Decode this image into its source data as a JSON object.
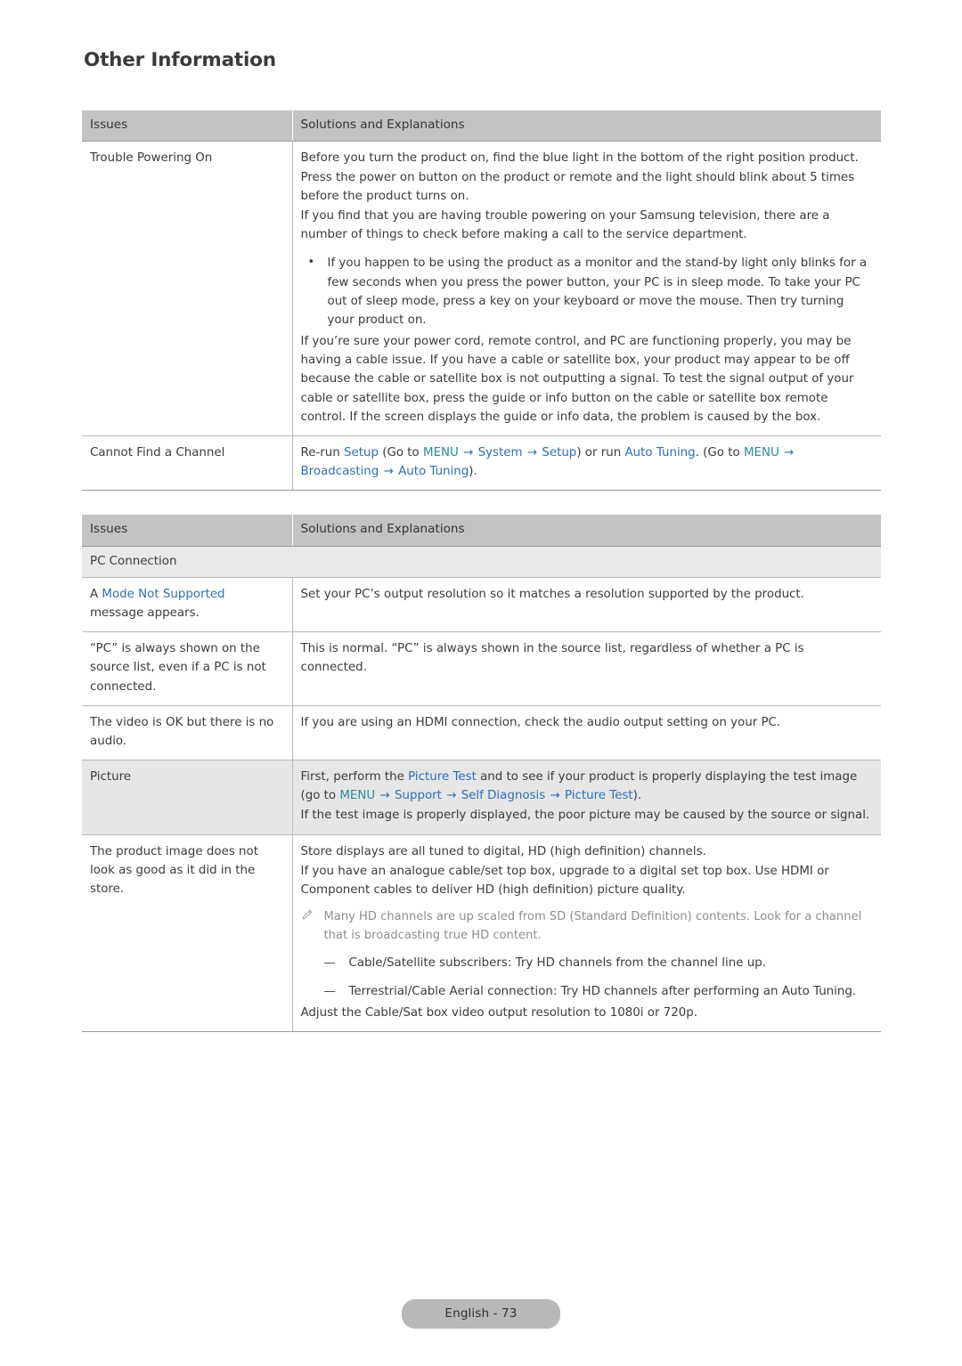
{
  "document": {
    "title": "Other Information",
    "footer_label": "English - 73"
  },
  "colors": {
    "menu_teal": "#2c8b9e",
    "link_blue": "#2f6fb4",
    "header_gray": "#c3c3c3",
    "subhead_gray": "#e9e9e9",
    "shaded_row": "#e6e6e6",
    "note_gray": "#8e8e8e"
  },
  "table1": {
    "headers": {
      "issues": "Issues",
      "solutions": "Solutions and Explanations"
    },
    "rows": [
      {
        "issue": "Trouble Powering On",
        "paragraphs": [
          "Before you turn the product on, find the blue light in the bottom of the right position product. Press the power on button on the product or remote and the light should blink about 5 times before the product turns on.",
          "If you find that you are having trouble powering on your Samsung television, there are a number of things to check before making a call to the service department."
        ],
        "bullet": "If you happen to be using the product as a monitor and the stand-by light only blinks for a few seconds when you press the power button, your PC is in sleep mode. To take your PC out of sleep mode, press a key on your keyboard or move the mouse. Then try turning your product on.",
        "bullet_marker": "•",
        "paragraph_after": "If you’re sure your power cord, remote control, and PC are functioning properly, you may be having a cable issue. If you have a cable or satellite box, your product may appear to be off because the cable or satellite box is not outputting a signal. To test the signal output of your cable or satellite box, press the guide or info button on the cable or satellite box remote control. If the screen displays the guide or info data, the problem is caused by the box."
      },
      {
        "issue": "Cannot Find a Channel",
        "rich": {
          "t1": "Re-run ",
          "k1": "Setup",
          "t2": " (Go to ",
          "k2": "MENU",
          "a1": "→",
          "k3": "System",
          "a2": "→",
          "k4": "Setup",
          "t3": ") or run ",
          "k5": "Auto Tuning",
          "t4": ". (Go to ",
          "k6": "MENU",
          "a3": "→",
          "k7": "Broadcasting",
          "a4": "→",
          "k8": "Auto Tuning",
          "t5": ")."
        }
      }
    ]
  },
  "table2": {
    "headers": {
      "issues": "Issues",
      "solutions": "Solutions and Explanations"
    },
    "subheading": "PC Connection",
    "rows": [
      {
        "issue_pre": "A ",
        "issue_link": "Mode Not Supported",
        "issue_post": "message appears.",
        "solution": "Set your PC’s output resolution so it matches a resolution supported by the product."
      },
      {
        "issue": "“PC” is always shown on the source list, even if a PC is not connected.",
        "solution": "This is normal. “PC” is always shown in the source list, regardless of whether a PC is connected."
      },
      {
        "issue": "The video is OK but there is no audio.",
        "solution": "If you are using an HDMI connection, check the audio output setting on your PC."
      },
      {
        "issue": "Picture",
        "rich": {
          "t1": "First, perform the ",
          "k1": "Picture Test",
          "t2": " and to see if your product is properly displaying the test image (go to ",
          "k2": "MENU",
          "a1": "→",
          "k3": "Support",
          "a2": "→",
          "k4": "Self Diagnosis",
          "a3": "→",
          "k5": "Picture Test",
          "t3": ")."
        },
        "solution2": "If the test image is properly displayed, the poor picture may be caused by the source or signal."
      },
      {
        "issue": "The product image does not look as good as it did in the store.",
        "paragraphs": [
          "Store displays are all tuned to digital, HD (high definition) channels.",
          "If you have an analogue cable/set top box, upgrade to a digital set top box. Use HDMI or Component cables to deliver HD (high definition) picture quality."
        ],
        "note": "Many HD channels are up scaled from SD (Standard Definition) contents. Look for a channel that is broadcasting true HD content.",
        "note_icon": "pencil-note-icon",
        "dashes": [
          "Cable/Satellite subscribers: Try HD channels from the channel line up.",
          "Terrestrial/Cable Aerial connection: Try HD channels after performing an Auto Tuning."
        ],
        "dash_marker": "—",
        "closing": "Adjust the Cable/Sat box video output resolution to 1080i or 720p."
      }
    ]
  }
}
